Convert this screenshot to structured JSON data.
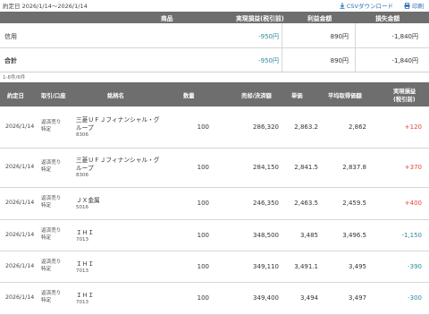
{
  "period": "約定日 2026/1/14〜2026/1/14",
  "actions": {
    "csv": "CSVダウンロード",
    "print": "印刷"
  },
  "summary": {
    "headers": {
      "product": "商品",
      "realized": "実現損益(税引前)",
      "profit": "利益金額",
      "loss": "損失金額"
    },
    "rows": [
      {
        "label": "信用",
        "realized": "-950円",
        "profit": "890円",
        "loss": "-1,840円"
      }
    ],
    "total": {
      "label": "合計",
      "realized": "-950円",
      "profit": "890円",
      "loss": "-1,840円"
    }
  },
  "count": "1-6件/6件",
  "detail": {
    "headers": {
      "date": "約定日",
      "kind": "取引/口座",
      "name": "銘柄名",
      "qty": "数量",
      "amount": "売却/決済額",
      "price": "単価",
      "avg": "平均取得価額",
      "pl_line1": "実現損益",
      "pl_line2": "(税引前)"
    },
    "rows": [
      {
        "date": "2026/1/14",
        "kind1": "返済売り",
        "kind2": "特定",
        "name1": "三菱ＵＦＪフィナンシャル・グ",
        "name2": "ループ",
        "code": "8306",
        "qty": "100",
        "amount": "286,320",
        "price": "2,863.2",
        "avg": "2,862",
        "pl": "+120"
      },
      {
        "date": "2026/1/14",
        "kind1": "返済売り",
        "kind2": "特定",
        "name1": "三菱ＵＦＪフィナンシャル・グ",
        "name2": "ループ",
        "code": "8306",
        "qty": "100",
        "amount": "284,150",
        "price": "2,841.5",
        "avg": "2,837.8",
        "pl": "+370"
      },
      {
        "date": "2026/1/14",
        "kind1": "返済売り",
        "kind2": "特定",
        "name1": "ＪＸ金属",
        "name2": "",
        "code": "5016",
        "qty": "100",
        "amount": "246,350",
        "price": "2,463.5",
        "avg": "2,459.5",
        "pl": "+400"
      },
      {
        "date": "2026/1/14",
        "kind1": "返済売り",
        "kind2": "特定",
        "name1": "ＩＨＩ",
        "name2": "",
        "code": "7013",
        "qty": "100",
        "amount": "348,500",
        "price": "3,485",
        "avg": "3,496.5",
        "pl": "-1,150"
      },
      {
        "date": "2026/1/14",
        "kind1": "返済売り",
        "kind2": "特定",
        "name1": "ＩＨＩ",
        "name2": "",
        "code": "7013",
        "qty": "100",
        "amount": "349,110",
        "price": "3,491.1",
        "avg": "3,495",
        "pl": "-390"
      },
      {
        "date": "2026/1/14",
        "kind1": "返済売り",
        "kind2": "特定",
        "name1": "ＩＨＩ",
        "name2": "",
        "code": "7013",
        "qty": "100",
        "amount": "349,400",
        "price": "3,494",
        "avg": "3,497",
        "pl": "-300"
      }
    ]
  },
  "colors": {
    "header_bg": "#6e6e6e",
    "positive": "#e0463c",
    "negative": "#2b8a9c",
    "link": "#2a6fb5"
  }
}
